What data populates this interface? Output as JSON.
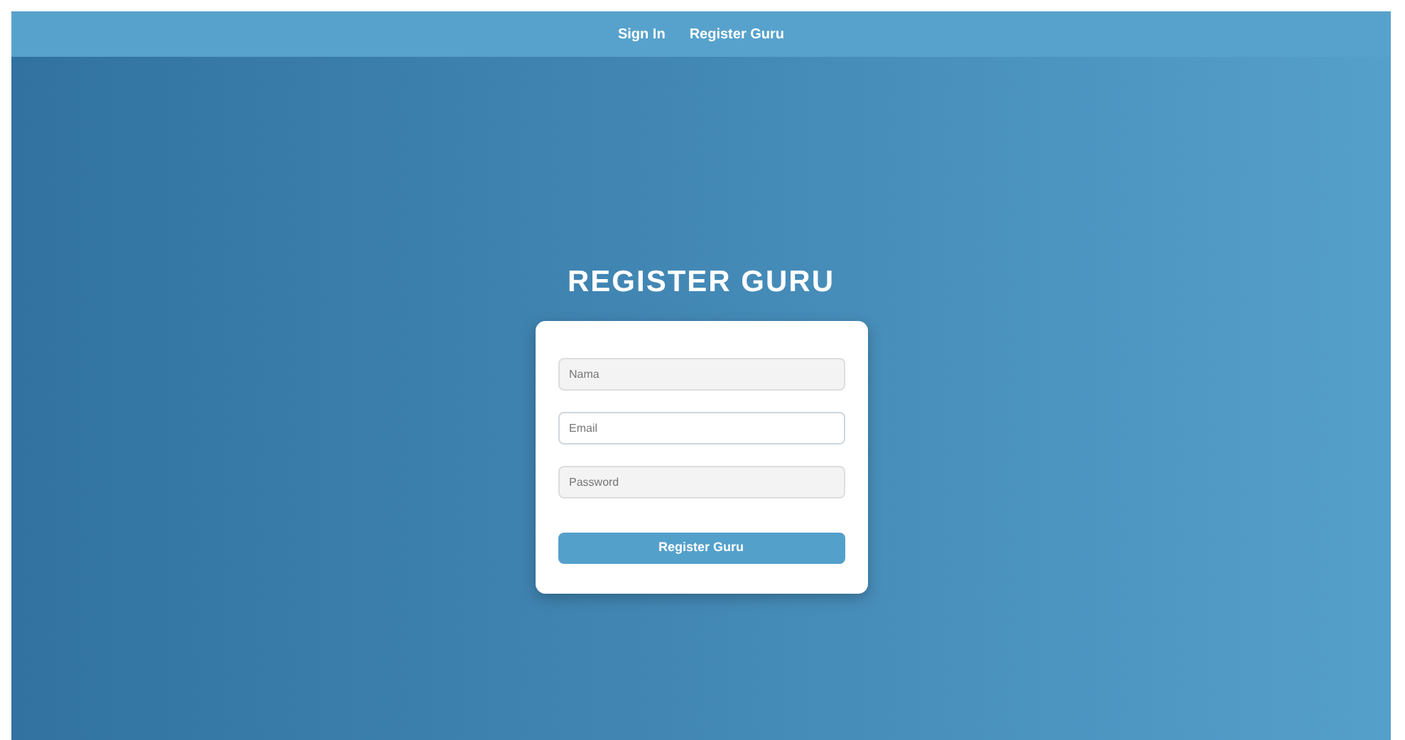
{
  "navbar": {
    "links": [
      {
        "label": "Sign In"
      },
      {
        "label": "Register Guru"
      }
    ]
  },
  "title": "REGISTER GURU",
  "form": {
    "fields": [
      {
        "placeholder": "Nama",
        "focused": false
      },
      {
        "placeholder": "Email",
        "focused": true
      },
      {
        "placeholder": "Password",
        "focused": false
      }
    ],
    "submit": "Register Guru"
  }
}
